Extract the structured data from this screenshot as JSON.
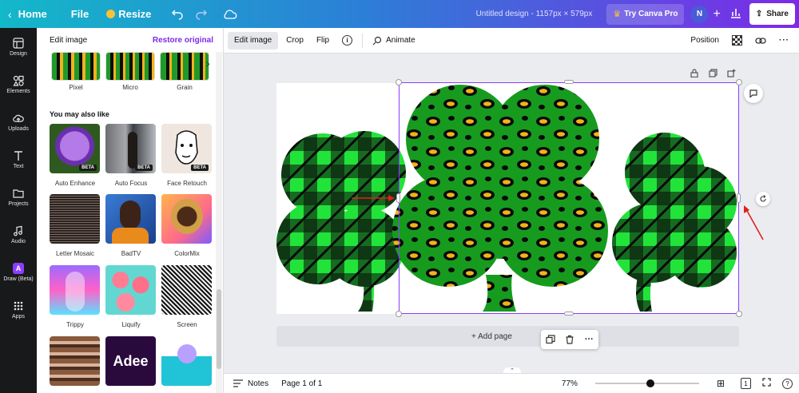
{
  "topbar": {
    "home": "Home",
    "file": "File",
    "resize": "Resize",
    "title": "Untitled design - 1157px × 579px",
    "try_pro": "Try Canva Pro",
    "avatar_initial": "N",
    "share": "Share"
  },
  "sidebar": {
    "items": [
      {
        "label": "Design",
        "icon": "design-icon"
      },
      {
        "label": "Elements",
        "icon": "elements-icon"
      },
      {
        "label": "Uploads",
        "icon": "uploads-icon"
      },
      {
        "label": "Text",
        "icon": "text-icon"
      },
      {
        "label": "Projects",
        "icon": "folder-icon"
      },
      {
        "label": "Audio",
        "icon": "music-note-icon"
      },
      {
        "label": "Draw (Beta)",
        "icon": "draw-icon"
      },
      {
        "label": "Apps",
        "icon": "apps-grid-icon"
      }
    ]
  },
  "panel": {
    "title": "Edit image",
    "restore": "Restore original",
    "top_effects": [
      "Pixel",
      "Micro",
      "Grain"
    ],
    "section_title": "You may also like",
    "effects": [
      {
        "label": "Auto Enhance",
        "badge": "BETA"
      },
      {
        "label": "Auto Focus",
        "badge": "BETA"
      },
      {
        "label": "Face Retouch",
        "badge": "BETA"
      },
      {
        "label": "Letter Mosaic"
      },
      {
        "label": "BadTV"
      },
      {
        "label": "ColorMix"
      },
      {
        "label": "Trippy"
      },
      {
        "label": "Liquify"
      },
      {
        "label": "Screen"
      },
      {
        "label": ""
      },
      {
        "label": "",
        "thumb_text": "Adee"
      },
      {
        "label": ""
      }
    ]
  },
  "context_bar": {
    "edit_image": "Edit image",
    "crop": "Crop",
    "flip": "Flip",
    "animate": "Animate",
    "position": "Position"
  },
  "canvas": {
    "add_page": "+ Add page"
  },
  "bottom_bar": {
    "notes": "Notes",
    "page_indicator": "Page 1 of 1",
    "zoom": "77%",
    "zoom_fraction": 0.77,
    "page_count": "1"
  },
  "colors": {
    "accent": "#7d2ae8",
    "shamrock_green": "#22e33a",
    "leopard_green": "#169b1f",
    "leopard_gold": "#f2b31a",
    "selection": "#8b3dff",
    "annotation_arrow": "#e0201b"
  }
}
